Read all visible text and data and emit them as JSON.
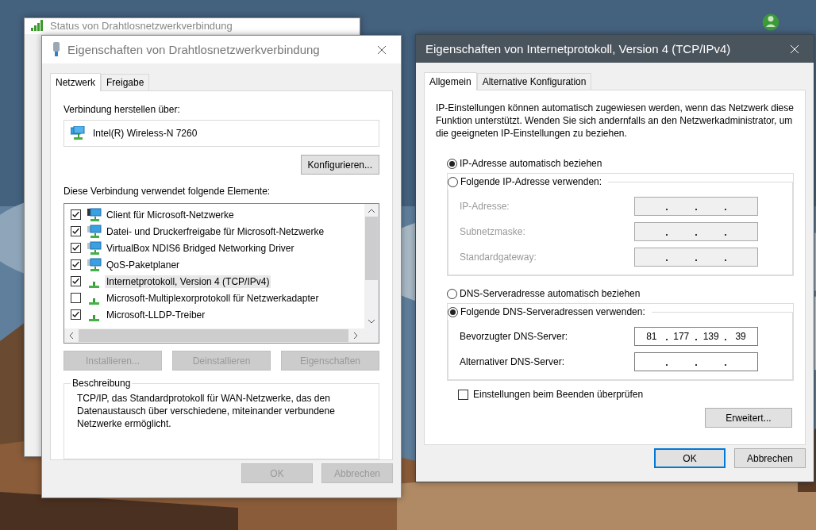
{
  "status_window": {
    "title": "Status von Drahtlosnetzwerkverbindung",
    "active": false
  },
  "wlan_window": {
    "title": "Eigenschaften von Drahtlosnetzwerkverbindung",
    "active": false,
    "tabs": [
      {
        "label": "Netzwerk",
        "selected": true
      },
      {
        "label": "Freigabe",
        "selected": false
      }
    ],
    "connect_label": "Verbindung herstellen über:",
    "adapter": "Intel(R) Wireless-N 7260",
    "configure_button": "Konfigurieren...",
    "elements_label": "Diese Verbindung verwendet folgende Elemente:",
    "elements": [
      {
        "label": "Client für Microsoft-Netzwerke",
        "kind": "client",
        "checked": true,
        "selected": false
      },
      {
        "label": "Datei- und Druckerfreigabe für Microsoft-Netzwerke",
        "kind": "service",
        "checked": true,
        "selected": false
      },
      {
        "label": "VirtualBox NDIS6 Bridged Networking Driver",
        "kind": "service",
        "checked": true,
        "selected": false
      },
      {
        "label": "QoS-Paketplaner",
        "kind": "service",
        "checked": true,
        "selected": false
      },
      {
        "label": "Internetprotokoll, Version 4 (TCP/IPv4)",
        "kind": "protocol",
        "checked": true,
        "selected": true
      },
      {
        "label": "Microsoft-Multiplexorprotokoll für Netzwerkadapter",
        "kind": "protocol",
        "checked": false,
        "selected": false
      },
      {
        "label": "Microsoft-LLDP-Treiber",
        "kind": "protocol",
        "checked": true,
        "selected": false
      }
    ],
    "buttons": [
      {
        "label": "Installieren...",
        "disabled": true
      },
      {
        "label": "Deinstallieren",
        "disabled": true
      },
      {
        "label": "Eigenschaften",
        "disabled": true
      }
    ],
    "description": {
      "title": "Beschreibung",
      "text": "TCP/IP, das Standardprotokoll für WAN-Netzwerke, das den Datenaustausch über verschiedene, miteinander verbundene Netzwerke ermöglicht."
    },
    "footer_buttons": [
      {
        "label": "OK",
        "disabled": true,
        "default": false
      },
      {
        "label": "Abbrechen",
        "disabled": true,
        "default": false
      }
    ]
  },
  "ipv4_window": {
    "title": "Eigenschaften von Internetprotokoll, Version 4 (TCP/IPv4)",
    "active": true,
    "tabs": [
      {
        "label": "Allgemein",
        "selected": true
      },
      {
        "label": "Alternative Konfiguration",
        "selected": false
      }
    ],
    "intro": "IP-Einstellungen können automatisch zugewiesen werden, wenn das Netzwerk diese Funktion unterstützt. Wenden Sie sich andernfalls an den Netzwerkadministrator, um die geeigneten IP-Einstellungen zu beziehen.",
    "ip_modes": [
      {
        "label": "IP-Adresse automatisch beziehen",
        "selected": true
      },
      {
        "label": "Folgende IP-Adresse verwenden:",
        "selected": false
      }
    ],
    "ip_fields": [
      {
        "label": "IP-Adresse:",
        "disabled": true
      },
      {
        "label": "Subnetzmaske:",
        "disabled": true
      },
      {
        "label": "Standardgateway:",
        "disabled": true
      }
    ],
    "dns_modes": [
      {
        "label": "DNS-Serveradresse automatisch beziehen",
        "selected": false
      },
      {
        "label": "Folgende DNS-Serveradressen verwenden:",
        "selected": true
      }
    ],
    "dns_fields": [
      {
        "label": "Bevorzugter DNS-Server:",
        "disabled": false,
        "octets": [
          "81",
          "177",
          "139",
          "39"
        ]
      },
      {
        "label": "Alternativer DNS-Server:",
        "disabled": false
      }
    ],
    "validate": {
      "label": "Einstellungen beim Beenden überprüfen",
      "checked": false
    },
    "advanced_button": "Erweitert...",
    "footer_buttons": [
      {
        "label": "OK",
        "disabled": false,
        "default": true
      },
      {
        "label": "Abbrechen",
        "disabled": false,
        "default": false
      }
    ]
  }
}
